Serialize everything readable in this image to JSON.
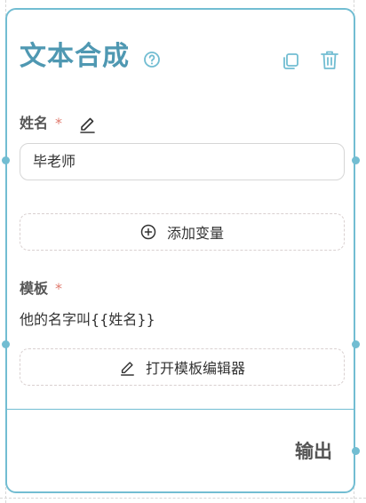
{
  "node": {
    "title": "文本合成",
    "icons": {
      "help": "help-circle-icon",
      "copy": "copy-icon",
      "delete": "trash-icon",
      "edit": "pencil-icon",
      "add": "plus-circle-icon"
    },
    "fields": {
      "name": {
        "label": "姓名",
        "required_mark": "*",
        "value": "毕老师"
      },
      "add_variable_label": "添加变量",
      "template": {
        "label": "模板",
        "required_mark": "*",
        "value": "他的名字叫{{姓名}}"
      },
      "open_editor_label": "打开模板编辑器"
    },
    "output_label": "输出"
  },
  "colors": {
    "accent": "#72bdd2",
    "title": "#4f98b2",
    "required": "#e07a6e"
  }
}
